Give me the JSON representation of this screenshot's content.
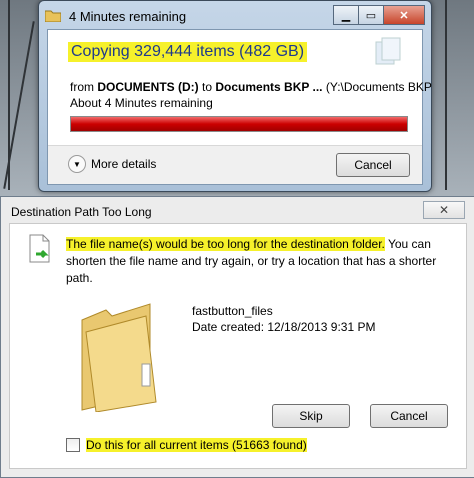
{
  "copy_window": {
    "title": "4 Minutes remaining",
    "heading": "Copying 329,444 items (482 GB)",
    "from_prefix": "from",
    "from_source": "DOCUMENTS (D:)",
    "from_to": "to",
    "from_dest": "Documents BKP ...",
    "from_path": "(Y:\\Documents BKP",
    "time_remaining": "About 4 Minutes remaining",
    "progress_fraction": 1.0,
    "more_details_label": "More details",
    "cancel_label": "Cancel"
  },
  "dialog": {
    "title": "Destination Path Too Long",
    "close_glyph": "✕",
    "message_highlight": "The file name(s) would be too long for the destination folder.",
    "message_rest": " You can shorten the file name and try again, or try a location that has a shorter path.",
    "file_name": "fastbutton_files",
    "date_created": "Date created: 12/18/2013 9:31 PM",
    "skip_label": "Skip",
    "cancel_label": "Cancel",
    "checkbox_label": "Do this for all current items (51663 found)",
    "checkbox_checked": false
  },
  "colors": {
    "highlight": "#f6f12b",
    "progress": "#cc0000",
    "heading_text": "#1e3a8c"
  }
}
